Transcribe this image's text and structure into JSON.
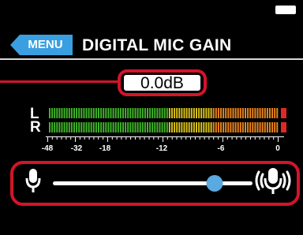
{
  "header": {
    "menu_label": "MENU",
    "title": "DIGITAL MIC GAIN"
  },
  "gain": {
    "value": "0.0dB"
  },
  "meter": {
    "channels": [
      "L",
      "R"
    ],
    "scale_labels": [
      "-48",
      "-32",
      "-18",
      "-12",
      "-6",
      "0"
    ],
    "colors": {
      "low": "#3fb428",
      "mid": "#d9c21a",
      "high": "#e8841c",
      "peak": "#e02828"
    }
  },
  "slider": {
    "level_fraction": 0.81,
    "left_icon": "mic-low-icon",
    "right_icon": "mic-high-icon",
    "knob_color": "#5aa9df"
  },
  "colors": {
    "accent": "#3a9fe0",
    "highlight": "#d3142a"
  }
}
